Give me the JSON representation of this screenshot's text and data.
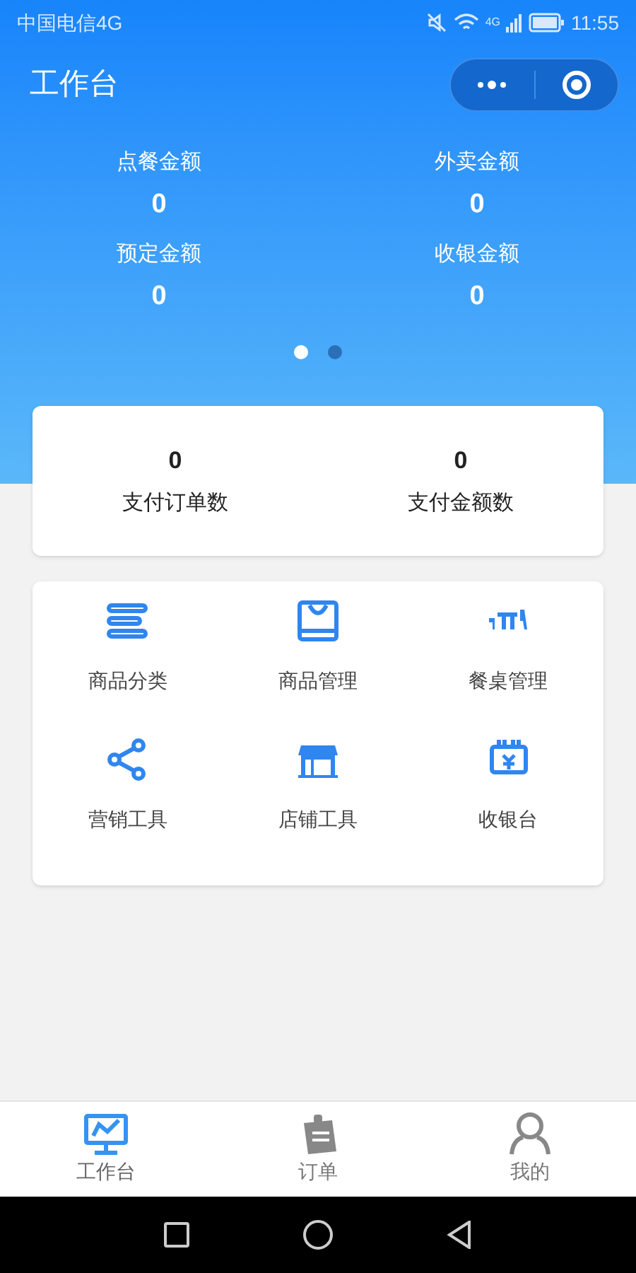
{
  "status_bar": {
    "carrier": "中国电信4G",
    "network": "4G",
    "time": "11:55"
  },
  "header": {
    "title": "工作台"
  },
  "summary": [
    {
      "label": "点餐金额",
      "value": "0"
    },
    {
      "label": "外卖金额",
      "value": "0"
    },
    {
      "label": "预定金额",
      "value": "0"
    },
    {
      "label": "收银金额",
      "value": "0"
    }
  ],
  "pager_dots": [
    {
      "selected": true
    },
    {
      "selected": false
    }
  ],
  "stats": [
    {
      "value": "0",
      "label": "支付订单数"
    },
    {
      "value": "0",
      "label": "支付金额数"
    }
  ],
  "tools": [
    {
      "label": "商品分类"
    },
    {
      "label": "商品管理"
    },
    {
      "label": "餐桌管理"
    },
    {
      "label": "营销工具"
    },
    {
      "label": "店铺工具"
    },
    {
      "label": "收银台"
    }
  ],
  "tabs": [
    {
      "label": "工作台",
      "selected": true
    },
    {
      "label": "订单",
      "selected": false
    },
    {
      "label": "我的",
      "selected": false
    }
  ]
}
